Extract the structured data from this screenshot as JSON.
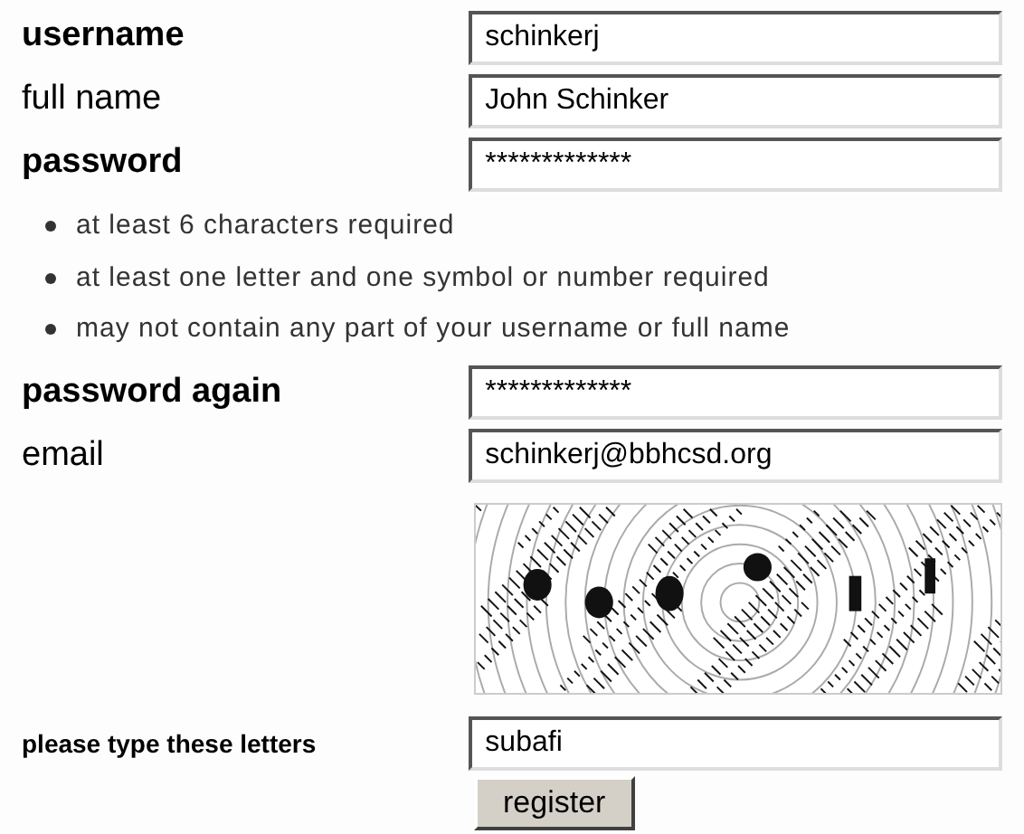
{
  "fields": [
    {
      "label": "username",
      "bold": true,
      "value": "schinkerj"
    },
    {
      "label": "full name",
      "bold": false,
      "value": "John Schinker"
    },
    {
      "label": "password",
      "bold": true,
      "value": "*************"
    }
  ],
  "password_rules": [
    "at least 6 characters required",
    "at least one letter and one symbol or number required",
    "may not contain any part of your username or full name"
  ],
  "fields_after": [
    {
      "label": "password again",
      "bold": true,
      "value": "*************"
    },
    {
      "label": "email",
      "bold": false,
      "value": "schinkerj@bbhcsd.org"
    }
  ],
  "captcha": {
    "kind": "picture",
    "label": "please type these letters",
    "value": "subafi"
  },
  "submit_button": "register"
}
